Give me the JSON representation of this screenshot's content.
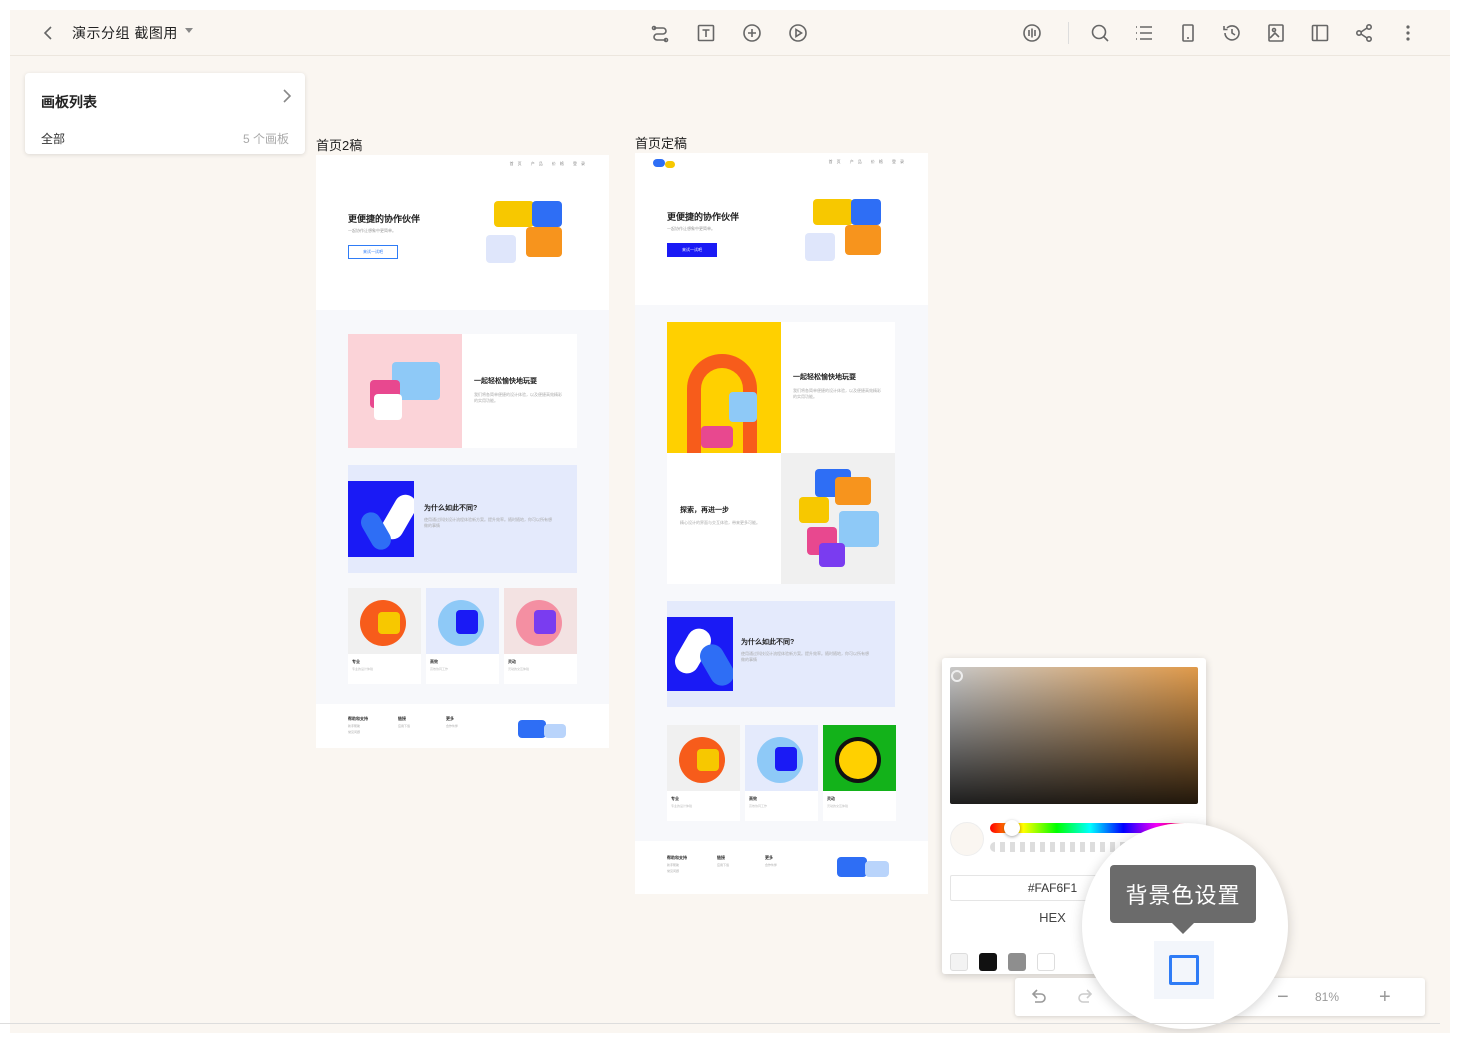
{
  "topbar": {
    "title": "演示分组 截图用",
    "tools_center": [
      "connector-icon",
      "text-tool-icon",
      "add-circle-icon",
      "play-icon"
    ],
    "tools_right": [
      "voice-icon",
      "search-icon",
      "list-icon",
      "device-icon",
      "history-icon",
      "export-image-icon",
      "export-rp-icon",
      "share-icon",
      "more-icon"
    ]
  },
  "panel": {
    "title": "画板列表",
    "all_label": "全部",
    "count": "5 个画板"
  },
  "boards": [
    {
      "label": "首页2稿",
      "hero_title": "更便捷的协作伙伴",
      "hero_sub": "一起协作让想象中更简单。",
      "hero_btn": "来试一试吧",
      "nav": "首页 产品 价格 登录",
      "sec1_title": "一起轻松愉快地玩耍",
      "sec1_text": "我们将各简单便捷的设计体验，以及便捷高效精彩的实用功能。",
      "sec2_title": "为什么如此不同?",
      "sec2_text": "使用通过科技设计流程体验新方案。提升效率。随时随地，你可以所有想做的事情",
      "cards": [
        {
          "title": "专业",
          "text": "专业的设计体验"
        },
        {
          "title": "高效",
          "text": "高效协同工作"
        },
        {
          "title": "灵动",
          "text": "灵动的交互体验"
        }
      ],
      "footer": [
        {
          "title": "帮助和支持",
          "lines": [
            "新手帮助",
            "常见问题",
            "联系我们",
            "意见反馈"
          ]
        },
        {
          "title": "链接",
          "lines": [
            "应用下载",
            "博客",
            "更新日志",
            "关于"
          ]
        },
        {
          "title": "更多",
          "lines": [
            "合作伙伴",
            "隐私政策",
            "服务条款",
            "加入我们"
          ]
        }
      ]
    },
    {
      "label": "首页定稿",
      "hero_title": "更便捷的协作伙伴",
      "hero_sub": "一起协作让想象中更简单。",
      "hero_btn": "来试一试吧",
      "nav": "首页 产品 价格 登录",
      "sec1_title": "一起轻松愉快地玩耍",
      "sec1_text": "我们将各简单便捷的设计体验，以及便捷高效精彩的实用功能。",
      "sec3_title": "探索，再进一步",
      "sec3_text": "精心设计的界面与交互体验，带来更多可能。",
      "sec2_title": "为什么如此不同?",
      "sec2_text": "使用通过科技设计流程体验新方案。提升效率。随时随地，你可以所有想做的事情",
      "cards": [
        {
          "title": "专业",
          "text": "专业的设计体验"
        },
        {
          "title": "高效",
          "text": "高效协同工作"
        },
        {
          "title": "灵动",
          "text": "灵动的交互体验"
        }
      ],
      "footer": [
        {
          "title": "帮助和支持",
          "lines": [
            "新手帮助",
            "常见问题",
            "联系我们",
            "意见反馈"
          ]
        },
        {
          "title": "链接",
          "lines": [
            "应用下载",
            "博客",
            "更新日志",
            "关于"
          ]
        },
        {
          "title": "更多",
          "lines": [
            "合作伙伴",
            "隐私政策",
            "服务条款",
            "加入我们"
          ]
        }
      ]
    }
  ],
  "picker": {
    "hex_value": "#FAF6F1",
    "hex_label": "HEX",
    "presets": [
      "#f3f3f3",
      "#111111",
      "#8e8e8e",
      "#ffffff"
    ]
  },
  "zoom": {
    "value": "81%",
    "minus": "−",
    "plus": "+"
  },
  "magnifier": {
    "tooltip": "背景色设置"
  },
  "colors": {
    "accent": "#2f7cf6",
    "canvas_bg": "#faf6f1",
    "brand_blue": "#1a1af5"
  }
}
